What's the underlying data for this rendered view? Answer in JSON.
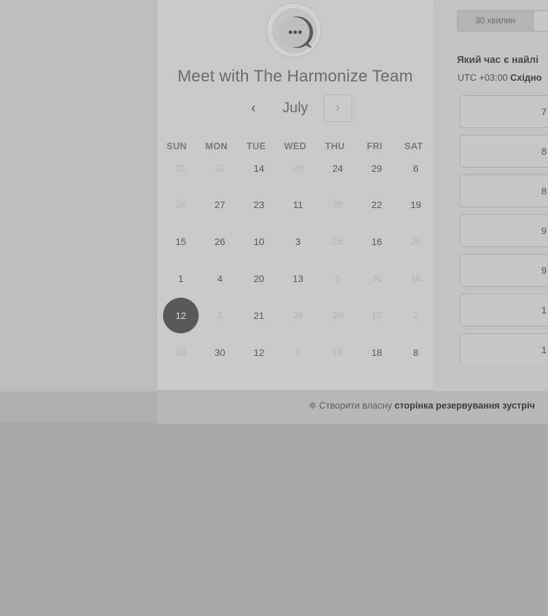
{
  "booking": {
    "title": "Meet with The Harmonize Team",
    "avatar_icon": "chat-bubble-icon",
    "month": "July",
    "prev_symbol": "‹",
    "next_symbol": "›",
    "weekdays": [
      "SUN",
      "MON",
      "TUE",
      "WED",
      "THU",
      "FRI",
      "SAT"
    ],
    "weeks": [
      [
        {
          "d": "21",
          "on": false
        },
        {
          "d": "22",
          "on": false
        },
        {
          "d": "14",
          "on": true
        },
        {
          "d": "28",
          "on": false
        },
        {
          "d": "24",
          "on": true
        },
        {
          "d": "29",
          "on": true
        },
        {
          "d": "6",
          "on": true
        }
      ],
      [
        {
          "d": "28",
          "on": false
        },
        {
          "d": "27",
          "on": true
        },
        {
          "d": "23",
          "on": true
        },
        {
          "d": "11",
          "on": true
        },
        {
          "d": "28",
          "on": false
        },
        {
          "d": "22",
          "on": true
        },
        {
          "d": "19",
          "on": true
        }
      ],
      [
        {
          "d": "15",
          "on": true
        },
        {
          "d": "26",
          "on": true
        },
        {
          "d": "10",
          "on": true
        },
        {
          "d": "3",
          "on": true
        },
        {
          "d": "26",
          "on": false
        },
        {
          "d": "16",
          "on": true
        },
        {
          "d": "29",
          "on": false
        }
      ],
      [
        {
          "d": "1",
          "on": true
        },
        {
          "d": "4",
          "on": true
        },
        {
          "d": "20",
          "on": true
        },
        {
          "d": "13",
          "on": true
        },
        {
          "d": "9",
          "on": false
        },
        {
          "d": "30",
          "on": false
        },
        {
          "d": "16",
          "on": false
        }
      ],
      [
        {
          "d": "12",
          "on": true,
          "selected": true
        },
        {
          "d": "3",
          "on": false
        },
        {
          "d": "21",
          "on": true
        },
        {
          "d": "26",
          "on": false
        },
        {
          "d": "20",
          "on": false
        },
        {
          "d": "10",
          "on": false
        },
        {
          "d": "3",
          "on": false
        }
      ],
      [
        {
          "d": "28",
          "on": false
        },
        {
          "d": "30",
          "on": true
        },
        {
          "d": "12",
          "on": true
        },
        {
          "d": "7",
          "on": false
        },
        {
          "d": "19",
          "on": false
        },
        {
          "d": "18",
          "on": true
        },
        {
          "d": "8",
          "on": true
        }
      ]
    ]
  },
  "right_panel": {
    "duration_label": "30 хвилин",
    "question": "Який час є найлі",
    "timezone_prefix": "UTC +03:00 ",
    "timezone_name": "Східно",
    "slots": [
      "7",
      "8",
      "8",
      "9",
      "9",
      "1",
      "1"
    ]
  },
  "footer": {
    "icon": "hubspot-sprocket-icon",
    "text_plain": "Створити власну ",
    "text_bold": "сторінка резервування зустріч"
  }
}
